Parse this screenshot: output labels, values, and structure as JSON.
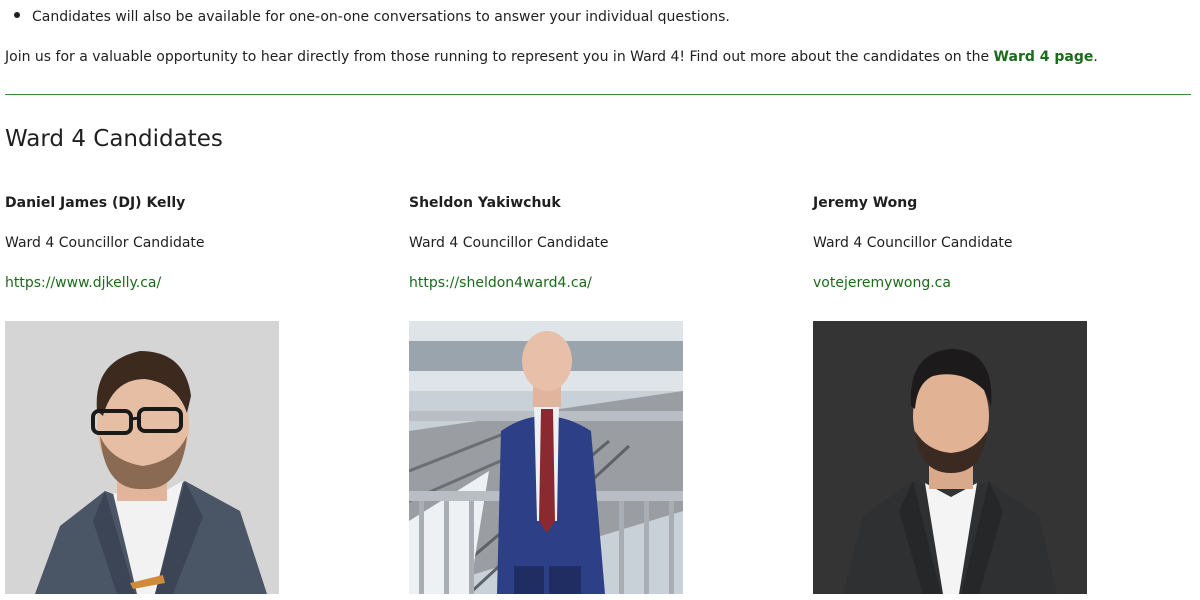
{
  "event": {
    "bullet_text": "Candidates will also be available for one-on-one conversations to answer your individual questions.",
    "intro_text": "Join us for a valuable opportunity to hear directly from those running to represent you in Ward 4! Find out more about the candidates on the ",
    "intro_link": "Ward 4 page",
    "intro_end": "."
  },
  "section": {
    "title": "Ward 4 Candidates"
  },
  "candidates": [
    {
      "name": "Daniel James (DJ) Kelly",
      "role": "Ward 4 Councillor Candidate",
      "website": "https://www.djkelly.ca/"
    },
    {
      "name": "Sheldon Yakiwchuk",
      "role": "Ward 4 Councillor Candidate",
      "website": "https://sheldon4ward4.ca/"
    },
    {
      "name": "Jeremy Wong",
      "role": "Ward 4 Councillor Candidate",
      "website": "votejeremywong.ca"
    }
  ],
  "colors": {
    "link_green": "#1a6b1a",
    "divider_green": "#3c8a3c",
    "text": "#1f1f1f"
  }
}
